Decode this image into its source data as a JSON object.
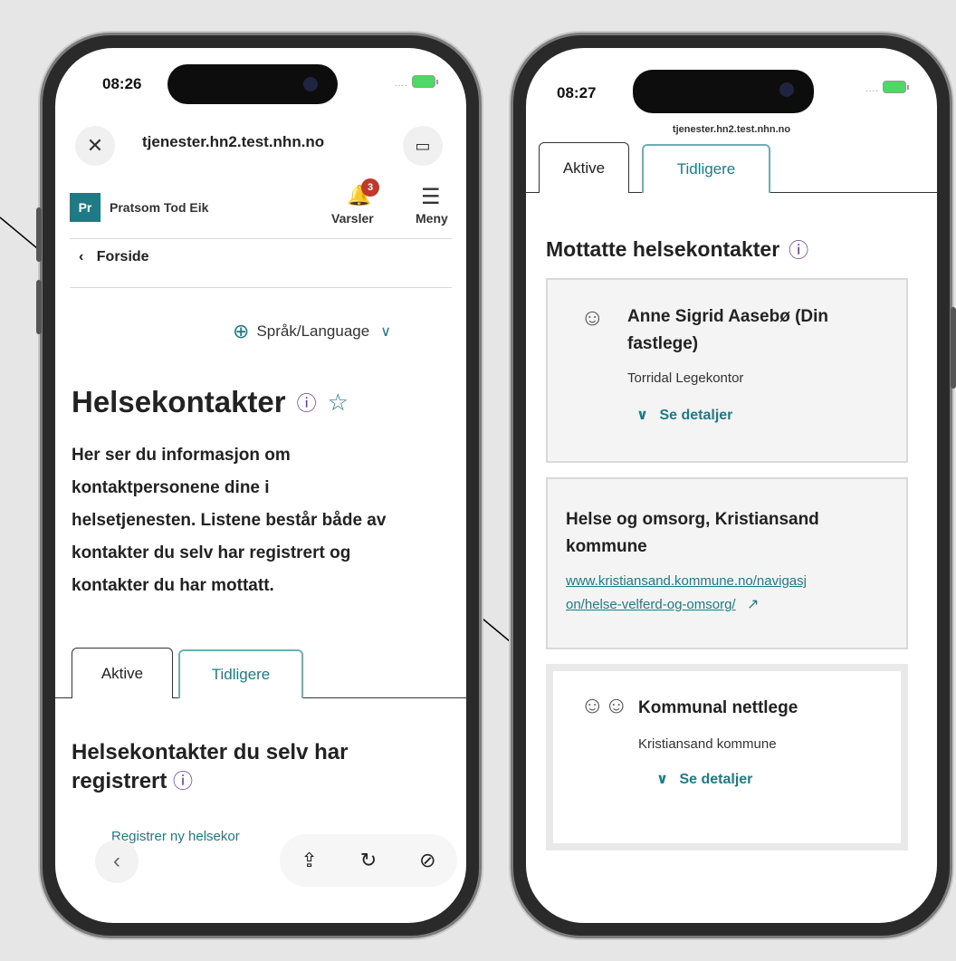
{
  "left": {
    "status": {
      "time": "08:26",
      "signal": "...."
    },
    "url": "tjenester.hn2.test.nhn.no",
    "user": {
      "initials": "Pr",
      "name": "Pratsom Tod Eik"
    },
    "notifications": {
      "count": "3",
      "label": "Varsler"
    },
    "menu_label": "Meny",
    "breadcrumb": "Forside",
    "language": "Språk/Language",
    "page_title": "Helsekontakter",
    "intro_lines": [
      "Her ser du informasjon om",
      "kontaktpersonene dine i",
      "helsetjenesten. Listene består både av",
      "kontakter du selv har registrert og",
      "kontakter du har mottatt."
    ],
    "tabs": [
      "Aktive",
      "Tidligere"
    ],
    "section_title_1": "Helsekontakter du selv har",
    "section_title_2": "registrert",
    "register_link": "Registrer ny helsekor"
  },
  "right": {
    "status": {
      "time": "08:27",
      "signal": "...."
    },
    "url": "tjenester.hn2.test.nhn.no",
    "tabs": [
      "Aktive",
      "Tidligere"
    ],
    "section_title": "Mottatte helsekontakter",
    "cards": [
      {
        "title_1": "Anne Sigrid Aasebø (Din",
        "title_2": "fastlege)",
        "subtitle": "Torridal Legekontor",
        "details": "Se detaljer"
      },
      {
        "title_1": "Helse og omsorg, Kristiansand",
        "title_2": "kommune",
        "link_1": "www.kristiansand.kommune.no/navigasj",
        "link_2": "on/helse-velferd-og-omsorg/"
      },
      {
        "title_1": "Kommunal nettlege",
        "subtitle": "Kristiansand kommune",
        "details": "Se detaljer"
      }
    ]
  }
}
